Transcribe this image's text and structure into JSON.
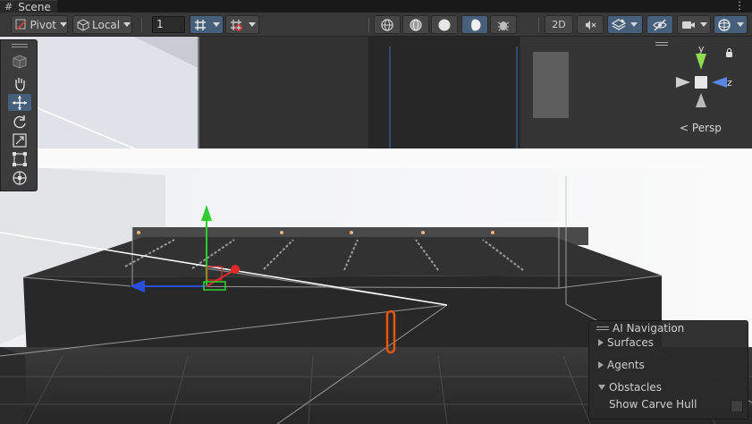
{
  "window": {
    "tab_label": "Scene",
    "menu_glyph": "⋮"
  },
  "toolbar": {
    "pivot_label": "Pivot",
    "space_label": "Local",
    "grid_size_value": "1",
    "mode_2d_label": "2D",
    "active_color": "#46607c"
  },
  "tools": [
    "view-tool",
    "move-hand-tool",
    "move-tool",
    "rotate-tool",
    "scale-tool",
    "rect-tool",
    "transform-tool"
  ],
  "gizmo": {
    "y_label": "y",
    "z_label": "z",
    "projection_label": "Persp",
    "y_color": "#8fdc4e",
    "z_color": "#5a86e6"
  },
  "ai_navigation": {
    "title": "AI Navigation",
    "items": [
      {
        "label": "Surfaces",
        "expanded": false
      },
      {
        "label": "Agents",
        "expanded": false
      },
      {
        "label": "Obstacles",
        "expanded": true
      }
    ],
    "show_carve_hull_label": "Show Carve Hull",
    "show_carve_hull_checked": false
  },
  "colors": {
    "x_axis": "#e22828",
    "y_axis": "#2ecc2e",
    "z_axis": "#2a4fe0",
    "capsule": "#e8560a"
  }
}
